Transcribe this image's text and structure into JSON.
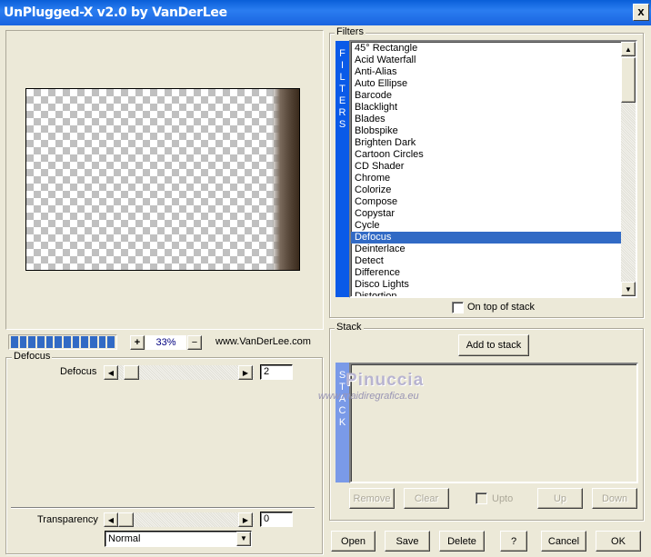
{
  "window": {
    "title": "UnPlugged-X v2.0 by VanDerLee",
    "close_label": "x"
  },
  "preview": {
    "zoom": "33%",
    "zoom_in": "+",
    "zoom_out": "−",
    "website": "www.VanDerLee.com",
    "progress_percent": 100
  },
  "defocus_group": {
    "title": "Defocus",
    "param_label": "Defocus",
    "param_value": "2"
  },
  "transparency": {
    "label": "Transparency",
    "value": "0",
    "blend_mode": "Normal"
  },
  "filters": {
    "title": "Filters",
    "side_label": "FILTERS",
    "selected": "Defocus",
    "items": [
      "45° Rectangle",
      "Acid Waterfall",
      "Anti-Alias",
      "Auto Ellipse",
      "Barcode",
      "Blacklight",
      "Blades",
      "Blobspike",
      "Brighten Dark",
      "Cartoon Circles",
      "CD Shader",
      "Chrome",
      "Colorize",
      "Compose",
      "Copystar",
      "Cycle",
      "Defocus",
      "Deinterlace",
      "Detect",
      "Difference",
      "Disco Lights",
      "Distortion"
    ],
    "on_top_label": "On top of stack",
    "on_top_checked": false
  },
  "stack": {
    "title": "Stack",
    "side_label": "STACK",
    "add_label": "Add to stack",
    "remove": "Remove",
    "clear": "Clear",
    "upto": "Upto",
    "up": "Up",
    "down": "Down"
  },
  "buttons": {
    "open": "Open",
    "save": "Save",
    "delete": "Delete",
    "help": "?",
    "cancel": "Cancel",
    "ok": "OK"
  },
  "watermark": {
    "name": "Pinuccia",
    "url": "www.maidiregrafica.eu"
  },
  "colors": {
    "titlebar": "#2a7df0",
    "selection": "#316ac5",
    "filters_strip": "#0a5ae8",
    "stack_strip": "#7a9ae8",
    "face": "#ece9d8"
  }
}
